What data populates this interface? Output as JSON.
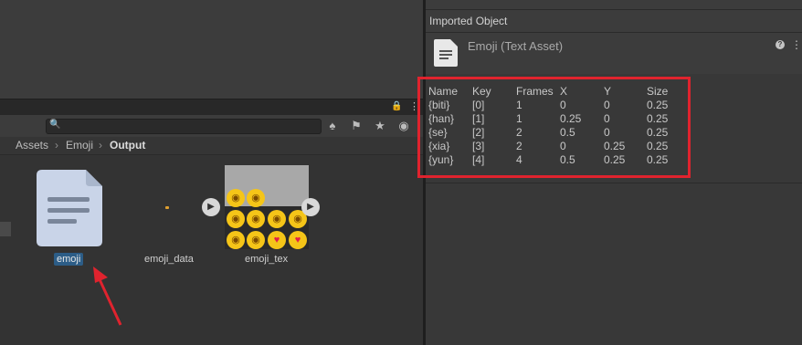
{
  "inspector": {
    "title": "Imported Object",
    "asset_name": "Emoji (Text Asset)",
    "help_icon": "help-icon",
    "table": {
      "headers": [
        "Name",
        "Key",
        "Frames",
        "X",
        "Y",
        "Size"
      ],
      "rows": [
        [
          "{biti}",
          "[0]",
          "1",
          "0",
          "0",
          "0.25"
        ],
        [
          "{han}",
          "[1]",
          "1",
          "0.25",
          "0",
          "0.25"
        ],
        [
          "{se}",
          "[2]",
          "2",
          "0.5",
          "0",
          "0.25"
        ],
        [
          "{xia}",
          "[3]",
          "2",
          "0",
          "0.25",
          "0.25"
        ],
        [
          "{yun}",
          "[4]",
          "4",
          "0.5",
          "0.25",
          "0.25"
        ]
      ]
    },
    "highlight_color": "#e0232e"
  },
  "project": {
    "breadcrumb": [
      "Assets",
      "Emoji",
      "Output"
    ],
    "assets": [
      {
        "label": "emoji",
        "icon": "text-document-icon",
        "selected": true
      },
      {
        "label": "emoji_data",
        "icon": "tiny-sprite-icon",
        "selected": false
      },
      {
        "label": "emoji_tex",
        "icon": "texture-thumbnail-icon",
        "selected": false
      }
    ],
    "toolbar_icons": [
      "filter-by-type-icon",
      "filter-by-label-icon",
      "favorites-star-icon",
      "hidden-packages-icon"
    ]
  },
  "annotation": {
    "arrow_color": "#e0232e"
  }
}
